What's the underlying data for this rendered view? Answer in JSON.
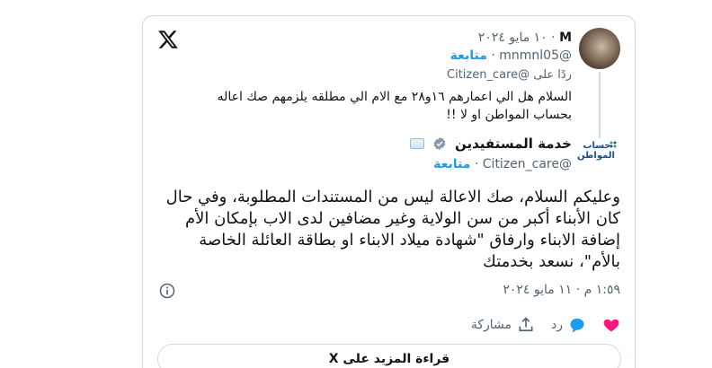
{
  "reply": {
    "name": "M",
    "separator": "·",
    "date": "١٠ مايو ٢٠٢٤",
    "handle": "@mnmnl05",
    "follow": "متابعة",
    "reply_to_prefix": "ردًا على",
    "reply_to_handle": "@Citizen_care",
    "text_line1": "السلام هل الي اعمارهم ١٦و٢٨ مع الام الي مطلقه يلزمهم صك اعاله",
    "text_line2": "بحساب المواطن او لا !!"
  },
  "tweet": {
    "author_name": "خدمة المستفيدين",
    "handle": "@Citizen_care",
    "separator": "·",
    "follow": "متابعة",
    "logo_text_line1": "حساب",
    "logo_text_line2": "المواطن",
    "body": "وعليكم السلام، صك الاعالة ليس من المستندات المطلوبة، وفي حال كان الأبناء أكبر من سن الولاية وغير مضافين لدى الاب بإمكان الأم إضافة الابناء وارفاق \"شهادة ميلاد الابناء او بطاقة العائلة الخاصة بالأم\"، نسعد بخدمتك",
    "time": "١:٥٩ م",
    "date": "١١ مايو ٢٠٢٤"
  },
  "actions": {
    "reply_label": "رد",
    "share_label": "مشاركة"
  },
  "read_more": "قراءة المزيد على X",
  "colors": {
    "accent": "#1d9bf0",
    "like": "#f91880",
    "border": "#cfd9de",
    "muted": "#536471"
  }
}
